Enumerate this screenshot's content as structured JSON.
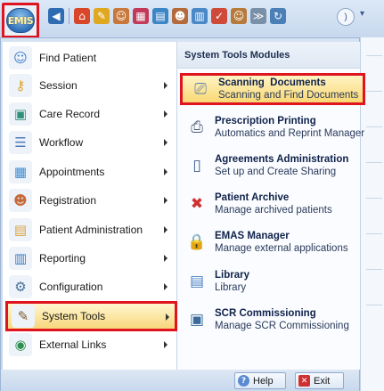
{
  "app": {
    "logo_text": "EMIS"
  },
  "quick_access": {
    "icons": [
      {
        "name": "back-icon",
        "glyph": "◀",
        "color": "#2f6db3"
      },
      {
        "name": "home-icon",
        "glyph": "⌂",
        "color": "#d9472b"
      },
      {
        "name": "pencil-icon",
        "glyph": "✎",
        "color": "#e0a81f"
      },
      {
        "name": "person-icon",
        "glyph": "☺",
        "color": "#c8783a"
      },
      {
        "name": "calendar-icon",
        "glyph": "▦",
        "color": "#c23a5a"
      },
      {
        "name": "monitor-icon",
        "glyph": "▤",
        "color": "#3c86c6"
      },
      {
        "name": "people-icon",
        "glyph": "☻",
        "color": "#b46a3a"
      },
      {
        "name": "report-icon",
        "glyph": "▥",
        "color": "#4a88c8"
      },
      {
        "name": "chart-icon",
        "glyph": "✓",
        "color": "#d04a3a"
      },
      {
        "name": "user-card-icon",
        "glyph": "☺",
        "color": "#b87a3a"
      },
      {
        "name": "forward-icon",
        "glyph": "≫",
        "color": "#7a8fa8"
      },
      {
        "name": "refresh-icon",
        "glyph": "↻",
        "color": "#4a7fb8"
      }
    ],
    "end_glyph": ")",
    "dropdown_glyph": "▾"
  },
  "left_menu": {
    "items": [
      {
        "label": "Find Patient",
        "icon": "find-patient-icon",
        "glyph": "☺",
        "color": "#3b7bc8",
        "arrow": false
      },
      {
        "label": "Session",
        "icon": "key-icon",
        "glyph": "⚷",
        "color": "#e0a21f",
        "arrow": true
      },
      {
        "label": "Care Record",
        "icon": "care-record-icon",
        "glyph": "▣",
        "color": "#2f8f7a",
        "arrow": true
      },
      {
        "label": "Workflow",
        "icon": "workflow-icon",
        "glyph": "☰",
        "color": "#4f79b8",
        "arrow": true
      },
      {
        "label": "Appointments",
        "icon": "appointments-icon",
        "glyph": "▦",
        "color": "#3c8bd0",
        "arrow": true
      },
      {
        "label": "Registration",
        "icon": "registration-icon",
        "glyph": "☻",
        "color": "#c66a3a",
        "arrow": true
      },
      {
        "label": "Patient Administration",
        "icon": "patient-admin-icon",
        "glyph": "▤",
        "color": "#d9a23a",
        "arrow": true
      },
      {
        "label": "Reporting",
        "icon": "reporting-icon",
        "glyph": "▥",
        "color": "#3c78c0",
        "arrow": true
      },
      {
        "label": "Configuration",
        "icon": "configuration-icon",
        "glyph": "⚙",
        "color": "#4a6f9a",
        "arrow": true
      },
      {
        "label": "System Tools",
        "icon": "pencil-icon",
        "glyph": "✎",
        "color": "#7a5a2a",
        "arrow": true
      },
      {
        "label": "External Links",
        "icon": "globe-icon",
        "glyph": "◉",
        "color": "#2f8f4f",
        "arrow": true
      }
    ]
  },
  "submenu": {
    "header": "System Tools Modules",
    "items": [
      {
        "title": "Scanning  Documents",
        "desc": "Scanning and Find Documents",
        "icon": "scanner-icon",
        "glyph": "⎚",
        "color": "#5a7ca8"
      },
      {
        "title": "Prescription Printing",
        "desc": "Automatics and Reprint Manager",
        "icon": "printer-icon",
        "glyph": "⎙",
        "color": "#4a5a72"
      },
      {
        "title": "Agreements Administration",
        "desc": "Set up and Create Sharing",
        "icon": "book-icon",
        "glyph": "▯",
        "color": "#3a5a8a"
      },
      {
        "title": "Patient Archive",
        "desc": "Manage archived patients",
        "icon": "archive-patient-icon",
        "glyph": "✖",
        "color": "#d03030"
      },
      {
        "title": "EMAS Manager",
        "desc": "Manage external applications",
        "icon": "lock-icon",
        "glyph": "🔒",
        "color": "#d8a020"
      },
      {
        "title": "Library",
        "desc": "Library",
        "icon": "library-icon",
        "glyph": "▤",
        "color": "#4a7fc0"
      },
      {
        "title": "SCR Commissioning",
        "desc": "Manage SCR Commissioning",
        "icon": "scr-icon",
        "glyph": "▣",
        "color": "#3a6a9a"
      }
    ]
  },
  "footer": {
    "help_label": "Help",
    "exit_label": "Exit",
    "help_glyph": "?",
    "exit_glyph": "✕"
  },
  "colors": {
    "highlight_border": "#e0141e",
    "selected_fill": "#f7d77c"
  }
}
